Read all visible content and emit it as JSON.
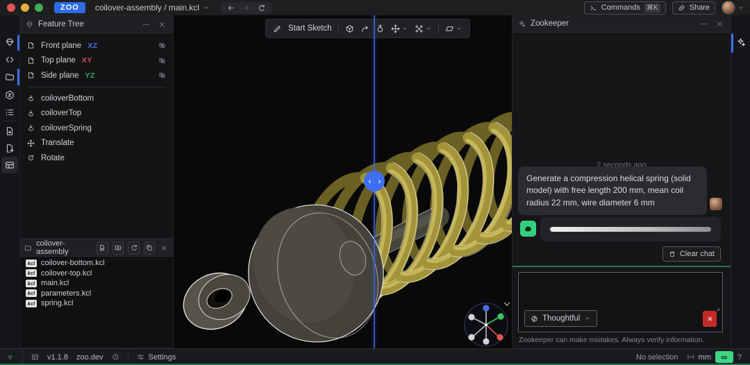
{
  "colors": {
    "accent_blue": "#3b6ff0",
    "logo_blue": "#2e6be5",
    "axis_x_red": "#d94f4f",
    "axis_y_green": "#3fa55f",
    "axis_z_blue": "#4b6fe0",
    "spring_olive": "#a3943a",
    "zookeeper_green": "#35d07e",
    "stop_red": "#c22a2a",
    "status_green": "#3fae6a"
  },
  "titlebar": {
    "logo": "ZOO",
    "breadcrumb": "coilover-assembly / main.kcl",
    "commands_label": "Commands",
    "commands_shortcut": "⌘K",
    "share_label": "Share"
  },
  "feature_tree": {
    "title": "Feature Tree",
    "planes": [
      {
        "label": "Front plane",
        "axis": "XZ"
      },
      {
        "label": "Top plane",
        "axis": "XY"
      },
      {
        "label": "Side plane",
        "axis": "YZ"
      }
    ],
    "operations": [
      {
        "label": "coiloverBottom"
      },
      {
        "label": "coiloverTop"
      },
      {
        "label": "coiloverSpring"
      },
      {
        "label": "Translate"
      },
      {
        "label": "Rotate"
      }
    ]
  },
  "file_explorer": {
    "project_name": "coilover-assembly",
    "badge": "kcl",
    "files": [
      {
        "name": "coilover-bottom.kcl"
      },
      {
        "name": "coilover-top.kcl"
      },
      {
        "name": "main.kcl"
      },
      {
        "name": "parameters.kcl"
      },
      {
        "name": "spring.kcl"
      }
    ]
  },
  "toolbar": {
    "start_sketch": "Start Sketch"
  },
  "zookeeper": {
    "title": "Zookeeper",
    "timestamp": "2 seconds ago",
    "user_message": "Generate a compression helical spring (solid model) with free length 200 mm, mean coil radius 22 mm, wire diameter 6 mm",
    "clear_chat_label": "Clear chat",
    "model_label": "Thoughtful",
    "disclaimer": "Zookeeper can make mistakes. Always verify information."
  },
  "status_bar": {
    "version": "v1.1.8",
    "domain": "zoo.dev",
    "settings_label": "Settings",
    "selection": "No selection",
    "units": "mm",
    "infinity": "∞",
    "help": "?"
  }
}
